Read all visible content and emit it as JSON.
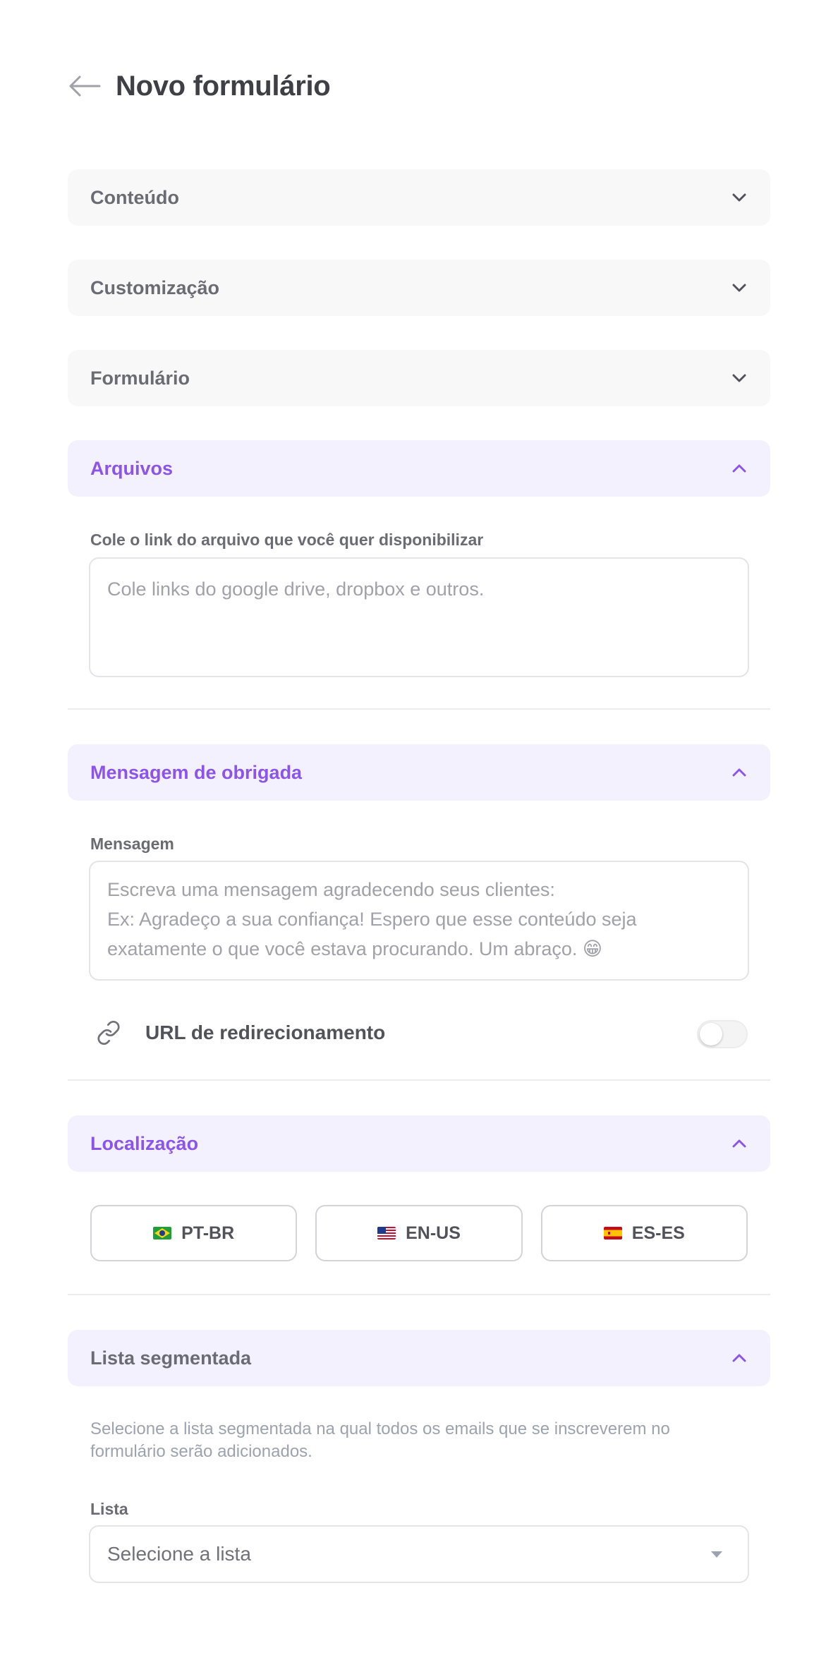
{
  "header": {
    "title": "Novo formulário"
  },
  "sections": {
    "conteudo": {
      "label": "Conteúdo"
    },
    "customizacao": {
      "label": "Customização"
    },
    "formulario": {
      "label": "Formulário"
    },
    "arquivos": {
      "label": "Arquivos",
      "field_label": "Cole o link do arquivo que você quer disponibilizar",
      "placeholder": "Cole links do google drive, dropbox e outros."
    },
    "mensagem": {
      "label": "Mensagem de obrigada",
      "field_label": "Mensagem",
      "placeholder_line1": "Escreva uma mensagem agradecendo seus clientes:",
      "placeholder_line2": "Ex: Agradeço a sua confiança!  Espero que esse conteúdo seja",
      "placeholder_line3": "exatamente o que você estava procurando. Um abraço. 😁",
      "url_label": "URL de redirecionamento",
      "url_toggle_on": false
    },
    "localizacao": {
      "label": "Localização",
      "languages": [
        {
          "code": "PT-BR",
          "flag": "brazil-flag-icon"
        },
        {
          "code": "EN-US",
          "flag": "usa-flag-icon"
        },
        {
          "code": "ES-ES",
          "flag": "spain-flag-icon"
        }
      ]
    },
    "lista": {
      "label": "Lista segmentada",
      "help_line1": "Selecione a lista segmentada na qual todos os emails que se inscreverem no",
      "help_line2": "formulário serão adicionados.",
      "field_label": "Lista",
      "select_value": "Selecione a lista"
    }
  },
  "colors": {
    "accent": "#8b54ea",
    "open_section_bg": "#f4f1fe",
    "collapsed_section_bg": "#f8f8f8",
    "text": "#3f3f46",
    "muted": "#a1a1aa"
  }
}
